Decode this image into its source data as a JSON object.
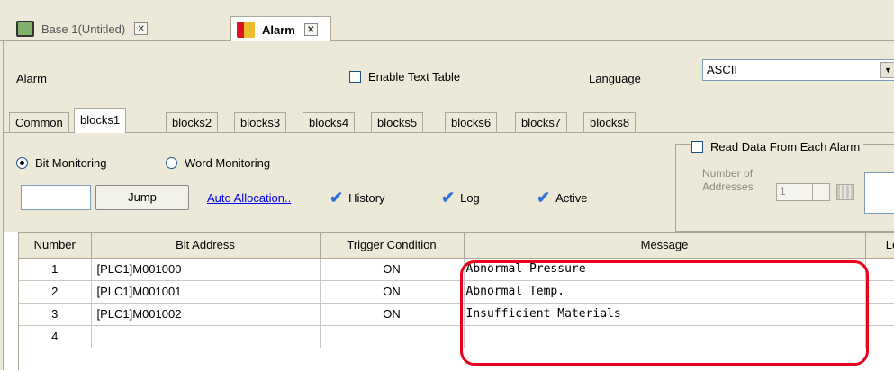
{
  "doc_tabs": [
    {
      "label": "Base 1(Untitled)",
      "close": "✕"
    },
    {
      "label": "Alarm",
      "close": "✕"
    }
  ],
  "header": {
    "title": "Alarm",
    "enable_text_table": "Enable Text Table",
    "language_label": "Language",
    "language_value": "ASCII"
  },
  "subtabs": [
    "Common",
    "blocks1",
    "blocks2",
    "blocks3",
    "blocks4",
    "blocks5",
    "blocks6",
    "blocks7",
    "blocks8"
  ],
  "monitoring": {
    "bit_label": "Bit Monitoring",
    "word_label": "Word Monitoring",
    "jump_label": "Jump",
    "auto_allocation": "Auto Allocation..",
    "history": "History",
    "log": "Log",
    "active": "Active",
    "read_data": "Read Data From Each Alarm",
    "number_of": "Number of",
    "addresses": "Addresses",
    "spin_value": "1"
  },
  "table": {
    "headers": [
      "Number",
      "Bit Address",
      "Trigger Condition",
      "Message",
      "Le"
    ],
    "rows": [
      {
        "number": "1",
        "address": "[PLC1]M001000",
        "trigger": "ON",
        "message": "Abnormal Pressure"
      },
      {
        "number": "2",
        "address": "[PLC1]M001001",
        "trigger": "ON",
        "message": "Abnormal Temp."
      },
      {
        "number": "3",
        "address": "[PLC1]M001002",
        "trigger": "ON",
        "message": "Insufficient Materials"
      },
      {
        "number": "4",
        "address": "",
        "trigger": "",
        "message": ""
      }
    ]
  },
  "colors": {
    "highlight": "#e8001c",
    "link": "#0000ee",
    "tick": "#2f6fd9"
  }
}
